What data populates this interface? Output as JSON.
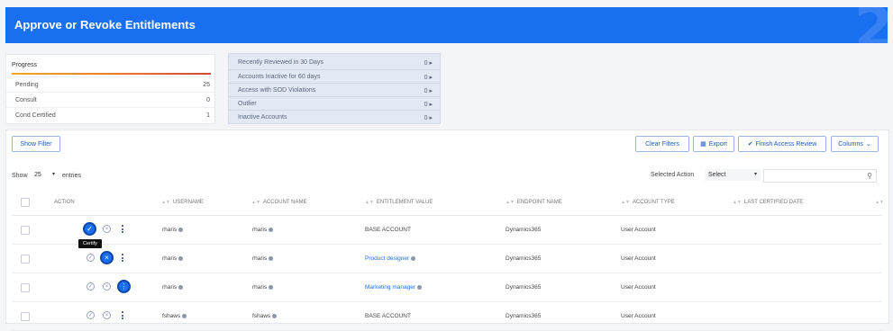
{
  "header": {
    "title": "Approve or Revoke Entitlements",
    "corner_glyph": "2"
  },
  "progress": {
    "title": "Progress",
    "rows": [
      {
        "label": "Pending",
        "value": "25"
      },
      {
        "label": "Consult",
        "value": "0"
      },
      {
        "label": "Cond Certified",
        "value": "1"
      }
    ]
  },
  "review_filters": [
    {
      "label": "Recently Reviewed in 30 Days",
      "value": "0 ▸"
    },
    {
      "label": "Accounts Inactive for 60 days",
      "value": "0 ▸"
    },
    {
      "label": "Access with SOD Violations",
      "value": "0 ▸"
    },
    {
      "label": "Outlier",
      "value": "0 ▸"
    },
    {
      "label": "Inactive Accounts",
      "value": "0 ▸"
    }
  ],
  "toolbar": {
    "show_filter": "Show Filter",
    "clear_filters": "Clear Filters",
    "export": "Export",
    "finish_review": "Finish Access Review",
    "columns": "Columns"
  },
  "entries": {
    "show_label": "Show",
    "page_size": "25",
    "entries_label": "entries"
  },
  "selected_action": {
    "label": "Selected Action",
    "value": "Select",
    "search_placeholder": ""
  },
  "columns": [
    "ACTION",
    "USERNAME",
    "ACCOUNT NAME",
    "ENTITLEMENT VALUE",
    "ENDPOINT NAME",
    "ACCOUNT TYPE",
    "LAST CERTIFIED DATE"
  ],
  "rows": [
    {
      "username": "rharis",
      "account": "rharis",
      "entitlement": "BASE ACCOUNT",
      "entitlement_link": false,
      "endpoint": "Dynamics365",
      "type": "User Account",
      "last": ""
    },
    {
      "username": "rharis",
      "account": "rharis",
      "entitlement": "Product designer",
      "entitlement_link": true,
      "endpoint": "Dynamics365",
      "type": "User Account",
      "last": ""
    },
    {
      "username": "rharis",
      "account": "rharis",
      "entitlement": "Marketing manager",
      "entitlement_link": true,
      "endpoint": "Dynamics365",
      "type": "User Account",
      "last": ""
    },
    {
      "username": "fshaws",
      "account": "fshaws",
      "entitlement": "BASE ACCOUNT",
      "entitlement_link": false,
      "endpoint": "Dynamics365",
      "type": "User Account",
      "last": ""
    }
  ],
  "tooltip": "Certify",
  "colors": {
    "header": "#1a6ff0",
    "accent": "#1a6ff0",
    "progress_bar": "#e8732a"
  }
}
